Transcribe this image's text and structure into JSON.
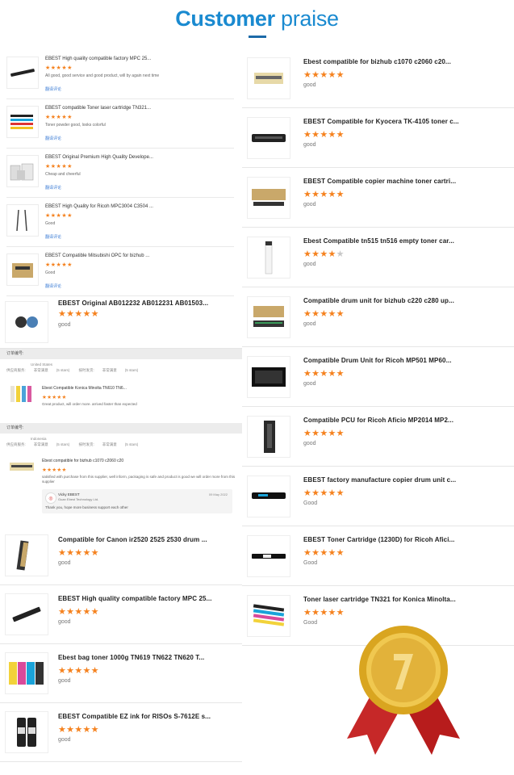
{
  "header": {
    "title_bold": "Customer",
    "title_light": " praise"
  },
  "small_reviews": [
    {
      "title": "EBEST High quality compatible factory MPC 25...",
      "stars": "★★★★★",
      "text": "All good, good service and good product, will by again next time",
      "translate": "翻译评论"
    },
    {
      "title": "EBEST compatible Toner laser cartridge TN321...",
      "stars": "★★★★★",
      "text": "Toner powder good, looks colorful",
      "translate": "翻译评论"
    },
    {
      "title": "EBEST Original Premium High Quality Develope...",
      "stars": "★★★★★",
      "text": "Cheap and cheerful",
      "translate": "翻译评论"
    },
    {
      "title": "EBEST High Quality for Ricoh MPC3004 C3504 ...",
      "stars": "★★★★★",
      "text": "Good",
      "translate": "翻译评论"
    },
    {
      "title": "EBEST Compatible Mitsubishi OPC for bizhub ...",
      "stars": "★★★★★",
      "text": "Good",
      "translate": "翻译评论"
    }
  ],
  "left_large_top": {
    "title": "EBEST Original AB012232 AB012231 AB01503...",
    "stars": "★★★★★",
    "text": "good"
  },
  "order1": {
    "bar": "订单编号:",
    "meta1": "United States",
    "meta_a": "供应商服务:",
    "meta_a2": "非常满意",
    "meta_a3": "(5 stars)",
    "meta_b": "按时发货:",
    "meta_b2": "非常满意",
    "meta_b3": "(5 stars)",
    "title": "Ebest Compatible Konica Minolta TN610 TN6...",
    "stars": "★★★★★",
    "text": "Great product, will order more. arrived faster than expected"
  },
  "order2": {
    "bar": "订单编号:",
    "meta1": "Indonesia",
    "meta_a": "供应商服务:",
    "meta_a2": "非常满意",
    "meta_a3": "(5 stars)",
    "meta_b": "按时发货:",
    "meta_b2": "非常满意",
    "meta_b3": "(5 stars)",
    "title": "Ebest compatible for bizhub c1070 c2060 c20",
    "stars": "★★★★★",
    "text": "satisfied with purchase from this supplier, well inform, packaging is safe and product is good we will order more from this supplier",
    "reply_name": "Vicky EBEST",
    "reply_company": "Guan Ebest Technology Ltd.",
    "reply_date": "09 May 2022",
    "reply_msg": "Thank you, hope more business support each other"
  },
  "left_large": [
    {
      "title": "Compatible for Canon ir2520 2525 2530 drum ...",
      "stars": "★★★★★",
      "text": "good"
    },
    {
      "title": "EBEST High quality compatible factory MPC 25...",
      "stars": "★★★★★",
      "text": "good"
    },
    {
      "title": "Ebest bag toner 1000g TN619 TN622 TN620 T...",
      "stars": "★★★★★",
      "text": "good"
    },
    {
      "title": "EBEST Compatible EZ ink for RISOs S-7612E s...",
      "stars": "★★★★★",
      "text": "good"
    }
  ],
  "right_items": [
    {
      "title": "Ebest compatible for bizhub c1070 c2060 c20...",
      "stars_on": "★★★★★",
      "stars_off": "",
      "rating": 5,
      "text": "good"
    },
    {
      "title": "EBEST Compatible for Kyocera TK-4105 toner c...",
      "stars_on": "★★★★★",
      "stars_off": "",
      "rating": 5,
      "text": "good"
    },
    {
      "title": "EBEST Compatible copier machine toner cartri...",
      "stars_on": "★★★★★",
      "stars_off": "",
      "rating": 5,
      "text": "good"
    },
    {
      "title": "Ebest Compatible tn515 tn516 empty toner car...",
      "stars_on": "★★★★",
      "stars_off": "★",
      "rating": 4,
      "text": "good"
    },
    {
      "title": "Compatible drum unit for bizhub c220 c280 up...",
      "stars_on": "★★★★★",
      "stars_off": "",
      "rating": 5,
      "text": "good"
    },
    {
      "title": "Compatible Drum Unit for Ricoh MP501 MP60...",
      "stars_on": "★★★★★",
      "stars_off": "",
      "rating": 5,
      "text": "good"
    },
    {
      "title": "Compatible PCU for Ricoh Aficio MP2014 MP2...",
      "stars_on": "★★★★★",
      "stars_off": "",
      "rating": 5,
      "text": "good"
    },
    {
      "title": "EBEST factory manufacture copier drum unit c...",
      "stars_on": "★★★★★",
      "stars_off": "",
      "rating": 5,
      "text": "Good"
    },
    {
      "title": "EBEST Toner Cartridge (1230D) for Ricoh Afici...",
      "stars_on": "★★★★★",
      "stars_off": "",
      "rating": 5,
      "text": "Good"
    },
    {
      "title": "Toner laser cartridge TN321 for Konica Minolta...",
      "stars_on": "★★★★★",
      "stars_off": "",
      "rating": 5,
      "text": "Good"
    }
  ],
  "colors": {
    "accent": "#1a8ad0",
    "star": "#f5821f",
    "medal_gold": "#d9a520",
    "ribbon": "#c62828"
  }
}
